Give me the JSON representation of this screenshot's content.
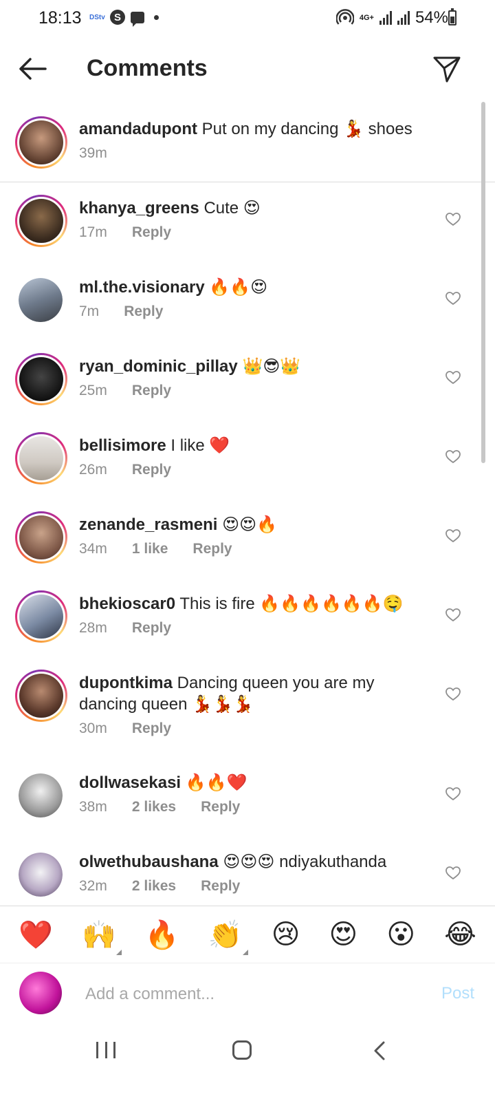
{
  "status_bar": {
    "time": "18:13",
    "carrier_badge": "DStv",
    "s_icon": "S",
    "network": "4G+",
    "battery": "54%",
    "battery_level": 0.54
  },
  "header": {
    "title": "Comments"
  },
  "caption": {
    "username": "amandadupont",
    "text": "Put on my dancing 💃 shoes",
    "time": "39m"
  },
  "comments": [
    {
      "username": "khanya_greens",
      "text": "Cute 😍",
      "time": "17m",
      "likes": "",
      "reply": "Reply"
    },
    {
      "username": "ml.the.visionary",
      "text": "🔥🔥😍",
      "time": "7m",
      "likes": "",
      "reply": "Reply"
    },
    {
      "username": "ryan_dominic_pillay",
      "text": "👑😎👑",
      "time": "25m",
      "likes": "",
      "reply": "Reply"
    },
    {
      "username": "bellisimore",
      "text": "I like ❤️",
      "time": "26m",
      "likes": "",
      "reply": "Reply"
    },
    {
      "username": "zenande_rasmeni",
      "text": "😍😍🔥",
      "time": "34m",
      "likes": "1 like",
      "reply": "Reply"
    },
    {
      "username": "bhekioscar0",
      "text": "This is fire 🔥🔥🔥🔥🔥🔥🤤",
      "time": "28m",
      "likes": "",
      "reply": "Reply"
    },
    {
      "username": "dupontkima",
      "text": "Dancing queen you are my dancing queen 💃💃💃",
      "time": "30m",
      "likes": "",
      "reply": "Reply"
    },
    {
      "username": "dollwasekasi",
      "text": "🔥🔥❤️",
      "time": "38m",
      "likes": "2 likes",
      "reply": "Reply"
    },
    {
      "username": "olwethubaushana",
      "text": "😍😍😍 ndiyakuthanda",
      "time": "32m",
      "likes": "2 likes",
      "reply": "Reply"
    }
  ],
  "quick_reactions": [
    "❤️",
    "🙌",
    "🔥",
    "👏",
    "😢",
    "😍",
    "😮",
    "😂"
  ],
  "composer": {
    "placeholder": "Add a comment...",
    "post_label": "Post"
  },
  "colors": {
    "post_disabled": "#b2dffc",
    "meta_gray": "#8e8e8e",
    "text": "#262626"
  }
}
